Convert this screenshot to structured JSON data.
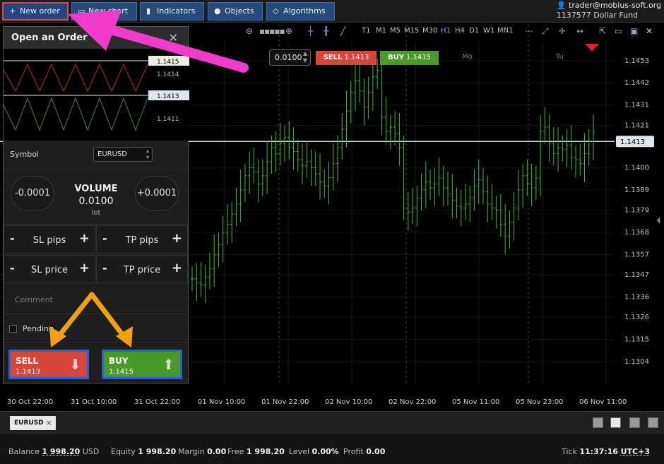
{
  "toolbar": {
    "new_order": "New order",
    "new_chart": "New chart",
    "indicators": "Indicators",
    "objects": "Objects",
    "algorithms": "Algorithms"
  },
  "account": {
    "email": "trader@mobius-soft.org",
    "id": "1137577",
    "fund": "Dollar Fund"
  },
  "chart_tools": {
    "timeframes": [
      "T1",
      "M1",
      "M5",
      "M15",
      "M30",
      "H1",
      "H4",
      "D1",
      "W1",
      "MN1"
    ],
    "active_timeframe": "H1"
  },
  "quick_trade": {
    "volume": "0.0100",
    "sell_label": "SELL",
    "sell_price": "1.1413",
    "buy_label": "BUY",
    "buy_price": "1.1415"
  },
  "order_panel": {
    "title": "Open an Order",
    "mini_chart_prices": [
      "1.1415",
      "1.1414",
      "1.1413",
      "1.1411"
    ],
    "symbol_label": "Symbol",
    "symbol_value": "EURUSD",
    "volume_minus": "-0.0001",
    "volume_plus": "+0.0001",
    "volume_title": "VOLUME",
    "volume_value": "0.0100",
    "volume_unit": "lot",
    "sl_pips": "SL pips",
    "tp_pips": "TP pips",
    "sl_price": "SL price",
    "tp_price": "TP price",
    "minus": "-",
    "plus": "+",
    "comment_placeholder": "Comment",
    "pending_label": "Pending",
    "sell_label": "SELL",
    "sell_price": "1.1413",
    "buy_label": "BUY",
    "buy_price": "1.1415"
  },
  "chart_data": {
    "type": "bar",
    "x_labels": [
      "30 Oct 22:00",
      "31 Oct 10:00",
      "31 Oct 22:00",
      "01 Nov 10:00",
      "01 Nov 22:00",
      "02 Nov 10:00",
      "02 Nov 22:00",
      "05 Nov 11:00",
      "05 Nov 23:00",
      "06 Nov 11:00"
    ],
    "day_labels": [
      "Mo",
      "Tu"
    ],
    "y_ticks": [
      "1.1453",
      "1.1442",
      "1.1431",
      "1.1421",
      "1.1400",
      "1.1389",
      "1.1379",
      "1.1368",
      "1.1357",
      "1.1347",
      "1.1336",
      "1.1326",
      "1.1315",
      "1.1304"
    ],
    "current_price": "1.1413",
    "ylim": [
      1.1296,
      1.1462
    ],
    "series": [
      {
        "values": [
          1.1345,
          1.1343,
          1.1342,
          1.1346,
          1.135,
          1.1357,
          1.1362,
          1.1368,
          1.1372,
          1.1377,
          1.1382,
          1.1389,
          1.1396,
          1.14,
          1.1398,
          1.1392,
          1.1396,
          1.1403,
          1.141,
          1.1407,
          1.1412,
          1.1415,
          1.141,
          1.1408,
          1.1404,
          1.1401,
          1.1403,
          1.14,
          1.1397,
          1.1393,
          1.1391,
          1.1395,
          1.1402,
          1.141,
          1.1419,
          1.1428,
          1.1437,
          1.1443,
          1.1438,
          1.143,
          1.1437,
          1.1445,
          1.1448,
          1.1425,
          1.1418,
          1.142,
          1.1417,
          1.141,
          1.138,
          1.1378,
          1.138,
          1.1385,
          1.1389,
          1.1393,
          1.139,
          1.1392,
          1.1395,
          1.139,
          1.1387,
          1.1384,
          1.1381,
          1.138,
          1.1382,
          1.1385,
          1.1391,
          1.1394,
          1.1388,
          1.1382,
          1.138,
          1.1379,
          1.1372,
          1.1366,
          1.1373,
          1.138,
          1.1389,
          1.1396,
          1.1392,
          1.139,
          1.1395,
          1.1418,
          1.142,
          1.1412,
          1.1407,
          1.141,
          1.1409,
          1.1411,
          1.1405,
          1.1404,
          1.1402,
          1.1407,
          1.1413,
          1.1418
        ]
      }
    ]
  },
  "bottom_tabs": {
    "symbol": "EURUSD",
    "close": "×"
  },
  "status": {
    "balance_label": "Balance",
    "balance_value": "1 998.20",
    "balance_currency": "USD",
    "equity_label": "Equity",
    "equity_value": "1 998.20",
    "margin_label": "Margin",
    "margin_value": "0.00",
    "free_label": "Free",
    "free_value": "1 998.20",
    "level_label": "Level",
    "level_value": "0.00%",
    "profit_label": "Profit",
    "profit_value": "0.00",
    "tick_label": "Tick",
    "tick_time": "11:37:16",
    "timezone": "UTC+3"
  },
  "colors": {
    "up_bar": "#3fbf2a",
    "sell": "#d8453a",
    "buy": "#4a9a2a",
    "annotation_arrow_pink": "#f03cc8",
    "annotation_arrow_orange": "#f0a010",
    "highlight_box": "#2563d8"
  }
}
